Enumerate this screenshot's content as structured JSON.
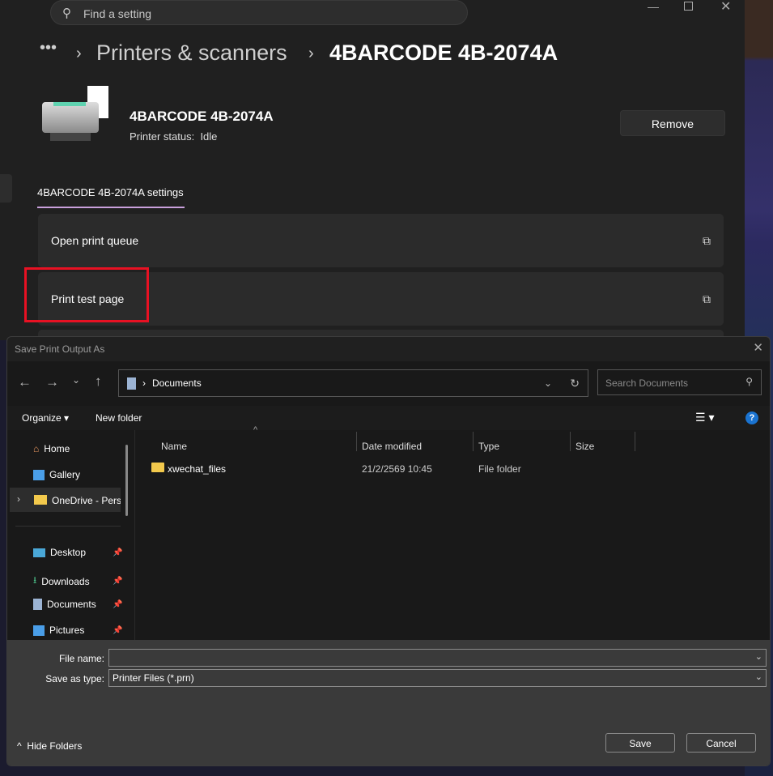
{
  "settings": {
    "search_placeholder": "Find a setting",
    "breadcrumb": {
      "more": "•••",
      "parent": "Printers & scanners",
      "current": "4BARCODE 4B-2074A"
    },
    "printer": {
      "name": "4BARCODE 4B-2074A",
      "status_label": "Printer status:",
      "status_value": "Idle"
    },
    "remove_label": "Remove",
    "tab_label": "4BARCODE 4B-2074A settings",
    "items": [
      {
        "label": "Open print queue"
      },
      {
        "label": "Print test page"
      }
    ],
    "highlight_color": "#e81123"
  },
  "dialog": {
    "title": "Save Print Output As",
    "address": "Documents",
    "search_placeholder": "Search Documents",
    "toolbar": {
      "organize": "Organize",
      "new_folder": "New folder"
    },
    "nav": [
      {
        "label": "Home",
        "icon": "home-icon"
      },
      {
        "label": "Gallery",
        "icon": "gallery-icon"
      },
      {
        "label": "OneDrive - Perso",
        "icon": "folder-icon"
      },
      {
        "label": "Desktop",
        "icon": "desktop-icon"
      },
      {
        "label": "Downloads",
        "icon": "download-icon"
      },
      {
        "label": "Documents",
        "icon": "documents-icon"
      },
      {
        "label": "Pictures",
        "icon": "pictures-icon"
      }
    ],
    "columns": [
      "Name",
      "Date modified",
      "Type",
      "Size"
    ],
    "files": [
      {
        "name": "xwechat_files",
        "date": "21/2/2569 10:45",
        "type": "File folder",
        "size": ""
      }
    ],
    "file_name_label": "File name:",
    "file_name_value": "",
    "save_type_label": "Save as type:",
    "save_type_value": "Printer Files (*.prn)",
    "hide_folders": "Hide Folders",
    "save": "Save",
    "cancel": "Cancel"
  }
}
